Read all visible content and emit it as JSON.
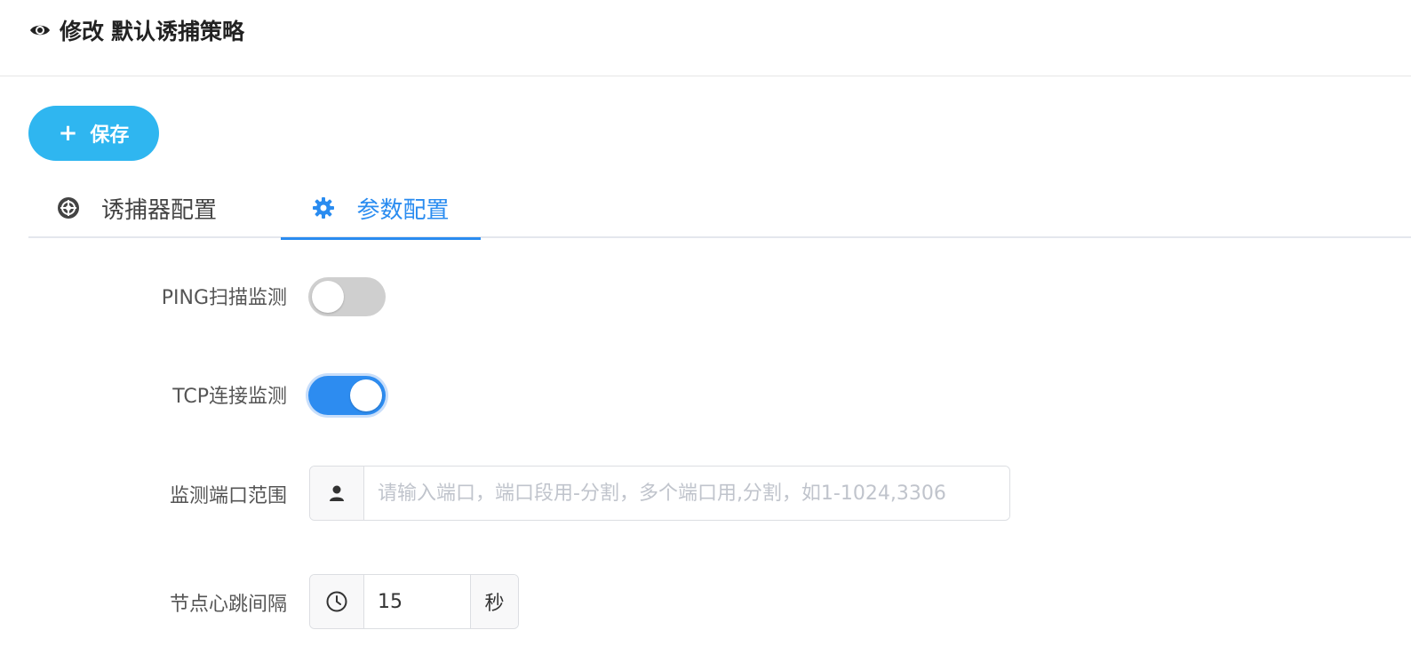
{
  "header": {
    "action": "修改",
    "title": "默认诱捕策略",
    "icon": "eye-icon"
  },
  "toolbar": {
    "save_label": "保存",
    "save_color": "#2fb6f0"
  },
  "tabs": [
    {
      "label": "诱捕器配置",
      "icon": "target-icon",
      "active": false
    },
    {
      "label": "参数配置",
      "icon": "gear-icon",
      "active": true
    }
  ],
  "accent_color": "#2a8cf0",
  "form": {
    "ping": {
      "label": "PING扫描监测",
      "enabled": false
    },
    "tcp": {
      "label": "TCP连接监测",
      "enabled": true
    },
    "ports": {
      "label": "监测端口范围",
      "value": "",
      "placeholder": "请输入端口，端口段用-分割，多个端口用,分割，如1-1024,3306",
      "icon": "user-icon"
    },
    "heartbeat": {
      "label": "节点心跳间隔",
      "value": "15",
      "unit": "秒",
      "icon": "clock-icon"
    }
  }
}
